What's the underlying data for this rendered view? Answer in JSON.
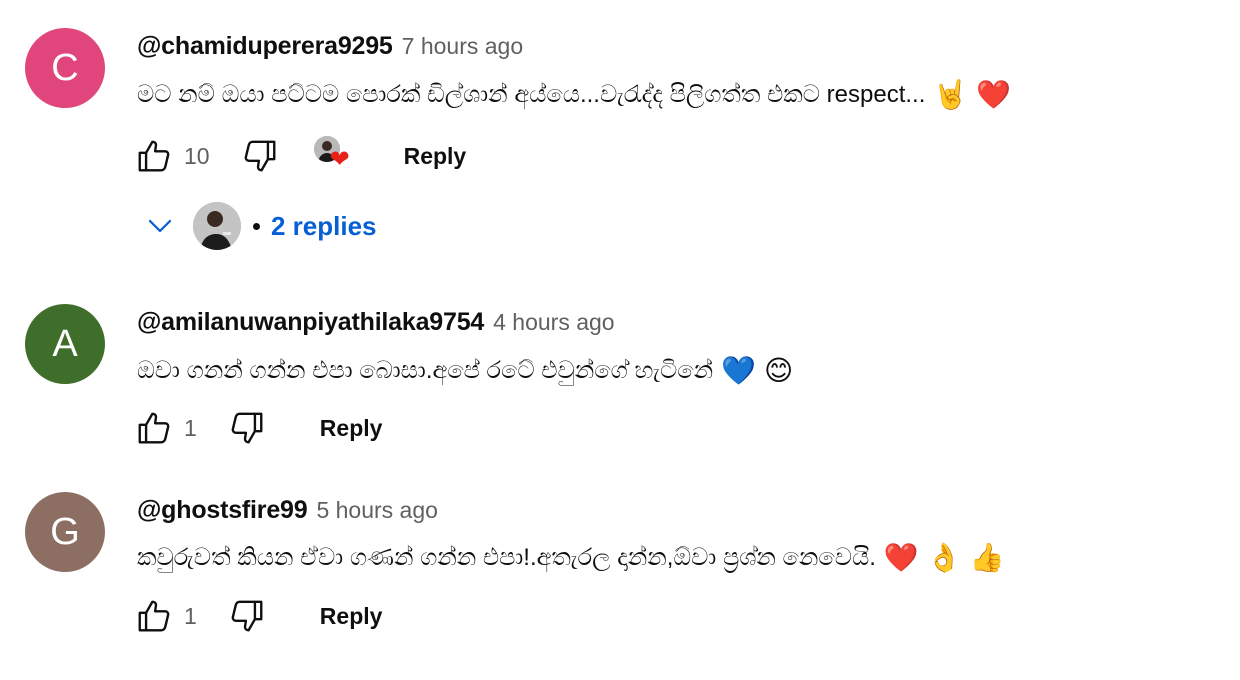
{
  "comments": [
    {
      "avatar_letter": "C",
      "avatar_color": "#e0457b",
      "author": "@chamiduperera9295",
      "time": "7 hours ago",
      "text": "මට නම් ඔයා පට්ටම පොරක් ඩිල්ශාන් අය්යෙ...වැරැද්ද පිලිගත්ත එකට respect...",
      "emojis": [
        "🤘",
        "❤️"
      ],
      "likes": "10",
      "reply_label": "Reply",
      "creator_heart": true,
      "replies": {
        "count_label": "2 replies"
      }
    },
    {
      "avatar_letter": "A",
      "avatar_color": "#3f6e2a",
      "author": "@amilanuwanpiyathilaka9754",
      "time": "4 hours ago",
      "text": "ඔවා ගනන් ගන්න එපා බොසා.අපේ රටේ එවුන්ගේ හැටිනේ",
      "emojis": [
        "💙",
        "😊"
      ],
      "likes": "1",
      "reply_label": "Reply"
    },
    {
      "avatar_letter": "G",
      "avatar_color": "#8d6e63",
      "author": "@ghostsfire99",
      "time": "5 hours ago",
      "text": "කවුරුවත් කියන ඒවා ගණන් ගන්න එපා!.අතැරල දාන්න,ඕවා ප්‍රශ්න නෙවෙයි.",
      "emojis": [
        "❤️",
        "👌",
        "👍"
      ],
      "likes": "1",
      "reply_label": "Reply"
    }
  ],
  "icons": {
    "like": "thumbs-up-icon",
    "dislike": "thumbs-down-icon",
    "expand": "chevron-down-icon",
    "heart": "heart-icon"
  },
  "colors": {
    "link_blue": "#065fd4",
    "secondary_text": "#606060",
    "heart_red": "#e62117"
  }
}
